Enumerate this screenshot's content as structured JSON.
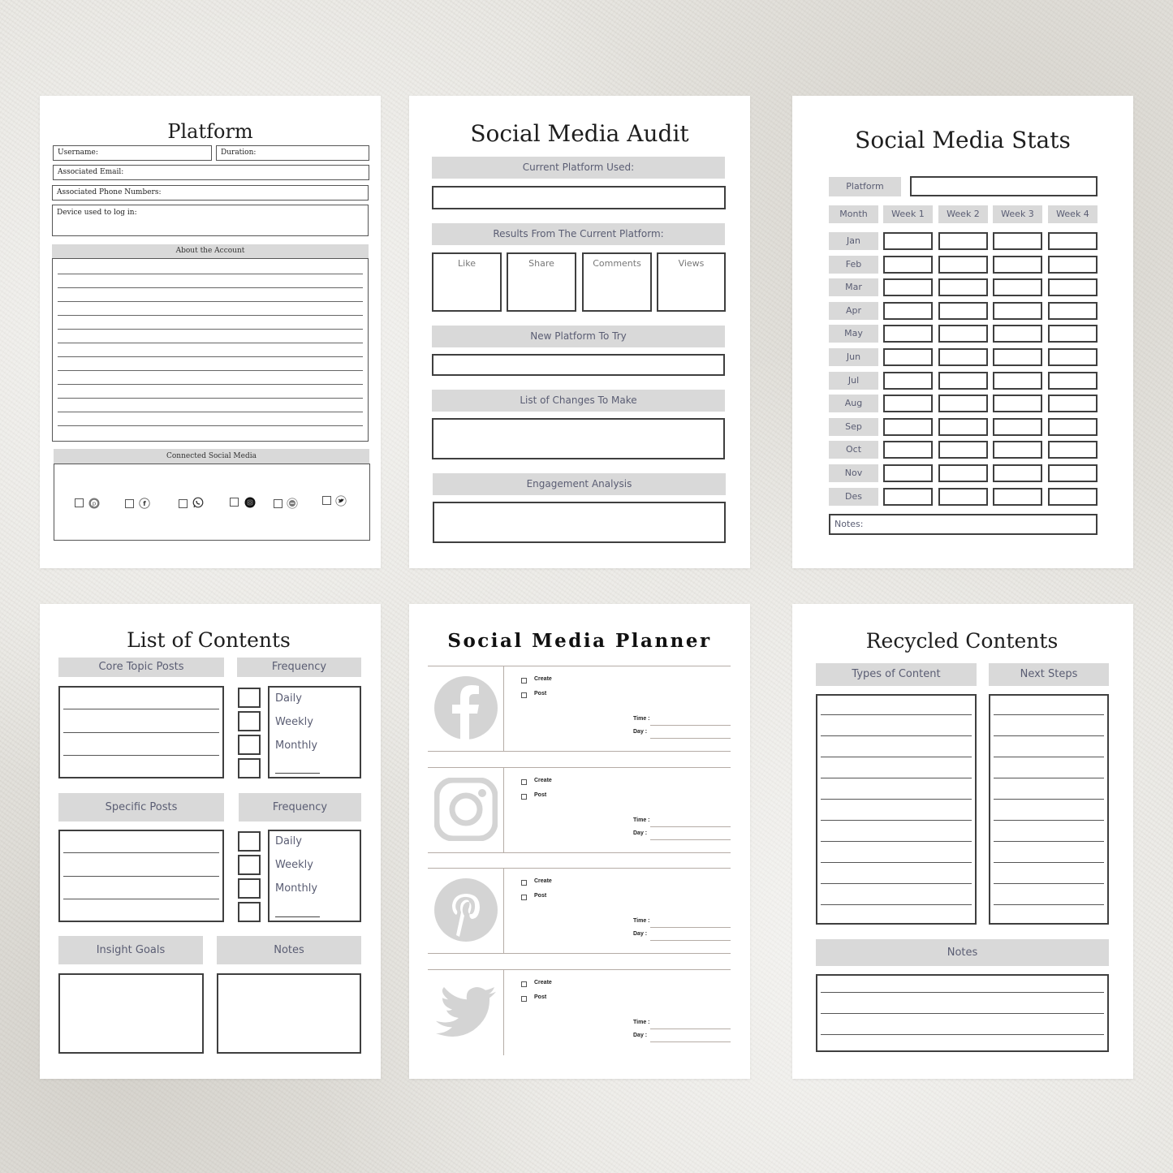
{
  "colors": {
    "bar_gray": "#d9d9d9",
    "label_slate": "#5a5d73",
    "icon_gray": "#d4d4d4",
    "border_dark": "#3f3f3f"
  },
  "platform": {
    "title": "Platform",
    "username_label": "Username:",
    "duration_label": "Duration:",
    "email_label": "Associated Email:",
    "phone_label": "Associated Phone Numbers:",
    "device_label": "Device used to log in:",
    "about_header": "About the Account",
    "connected_header": "Connected Social Media",
    "social_icons": [
      "pinterest-icon",
      "facebook-icon",
      "whatsapp-icon",
      "instagram-icon",
      "messenger-icon",
      "twitter-icon"
    ]
  },
  "audit": {
    "title": "Social Media Audit",
    "current_platform": "Current Platform Used:",
    "results_header": "Results From The Current Platform:",
    "metrics": [
      "Like",
      "Share",
      "Comments",
      "Views"
    ],
    "new_platform": "New Platform To Try",
    "changes": "List of Changes To Make",
    "engagement": "Engagement Analysis"
  },
  "stats": {
    "title": "Social Media Stats",
    "platform_label": "Platform",
    "month_label": "Month",
    "weeks": [
      "Week 1",
      "Week 2",
      "Week 3",
      "Week 4"
    ],
    "months": [
      "Jan",
      "Feb",
      "Mar",
      "Apr",
      "May",
      "Jun",
      "Jul",
      "Aug",
      "Sep",
      "Oct",
      "Nov",
      "Des"
    ],
    "notes_label": "Notes:"
  },
  "contents": {
    "title": "List of Contents",
    "core_header": "Core Topic Posts",
    "frequency_header": "Frequency",
    "specific_header": "Specific Posts",
    "frequency_options": [
      "Daily",
      "Weekly",
      "Monthly"
    ],
    "insight_header": "Insight Goals",
    "notes_header": "Notes"
  },
  "planner": {
    "title": "Social Media Planner",
    "rows": [
      {
        "platform": "facebook-icon"
      },
      {
        "platform": "instagram-icon"
      },
      {
        "platform": "pinterest-icon"
      },
      {
        "platform": "twitter-icon"
      }
    ],
    "create_label": "Create",
    "post_label": "Post",
    "time_label": "Time :",
    "day_label": "Day :"
  },
  "recycled": {
    "title": "Recycled Contents",
    "types_header": "Types of Content",
    "next_header": "Next Steps",
    "notes_header": "Notes"
  }
}
